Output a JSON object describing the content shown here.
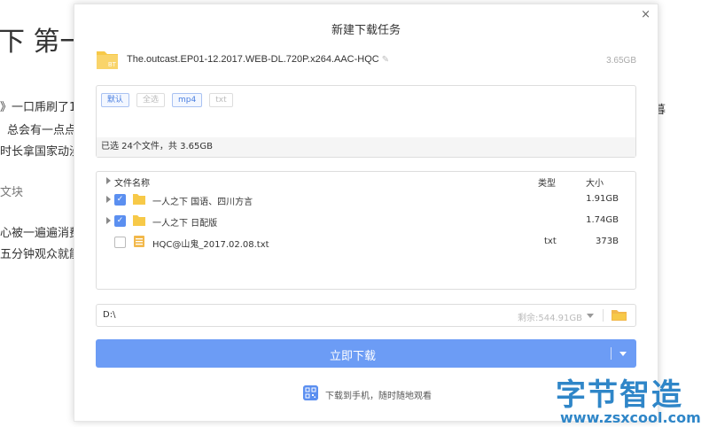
{
  "background": {
    "heading": "下 第一",
    "lines": [
      "》一口乕刷了1",
      "总会有一点点",
      "时长拿国家动漫",
      "文块",
      "心被一遍遍消费",
      "五分钟观众就能"
    ],
    "right_fragment": "暮"
  },
  "dialog": {
    "title": "新建下载任务",
    "close_label": "×",
    "file": {
      "icon_text": "BT",
      "name": "The.outcast.EP01-12.2017.WEB-DL.720P.x264.AAC-HQC",
      "edit_icon": "pencil-icon",
      "size": "3.65GB"
    },
    "filters": [
      {
        "label": "默认",
        "active": true
      },
      {
        "label": "全选",
        "active": false
      },
      {
        "label": "mp4",
        "active": true
      },
      {
        "label": "txt",
        "active": false
      }
    ],
    "selection_summary": "已选 24个文件，共 3.65GB",
    "table": {
      "headers": {
        "name": "文件名称",
        "type": "类型",
        "size": "大小"
      },
      "rows": [
        {
          "name": "一人之下 国语、四川方言",
          "type": "",
          "size": "1.91GB",
          "checked": true,
          "folder": true
        },
        {
          "name": "一人之下 日配版",
          "type": "",
          "size": "1.74GB",
          "checked": true,
          "folder": true
        },
        {
          "name": "HQC@山鬼_2017.02.08.txt",
          "type": "txt",
          "size": "373B",
          "checked": false,
          "folder": false
        }
      ]
    },
    "path": {
      "value": "D:\\",
      "free_space": "剩余:544.91GB"
    },
    "download_button": "立即下载",
    "mobile_text": "下载到手机，随时随地观看"
  },
  "watermark": {
    "cn": "字节智造",
    "en": "www.zsxcool.com"
  },
  "colors": {
    "accent": "#6c9cf5",
    "folder": "#f7c948",
    "watermark": "#2f86c8"
  }
}
